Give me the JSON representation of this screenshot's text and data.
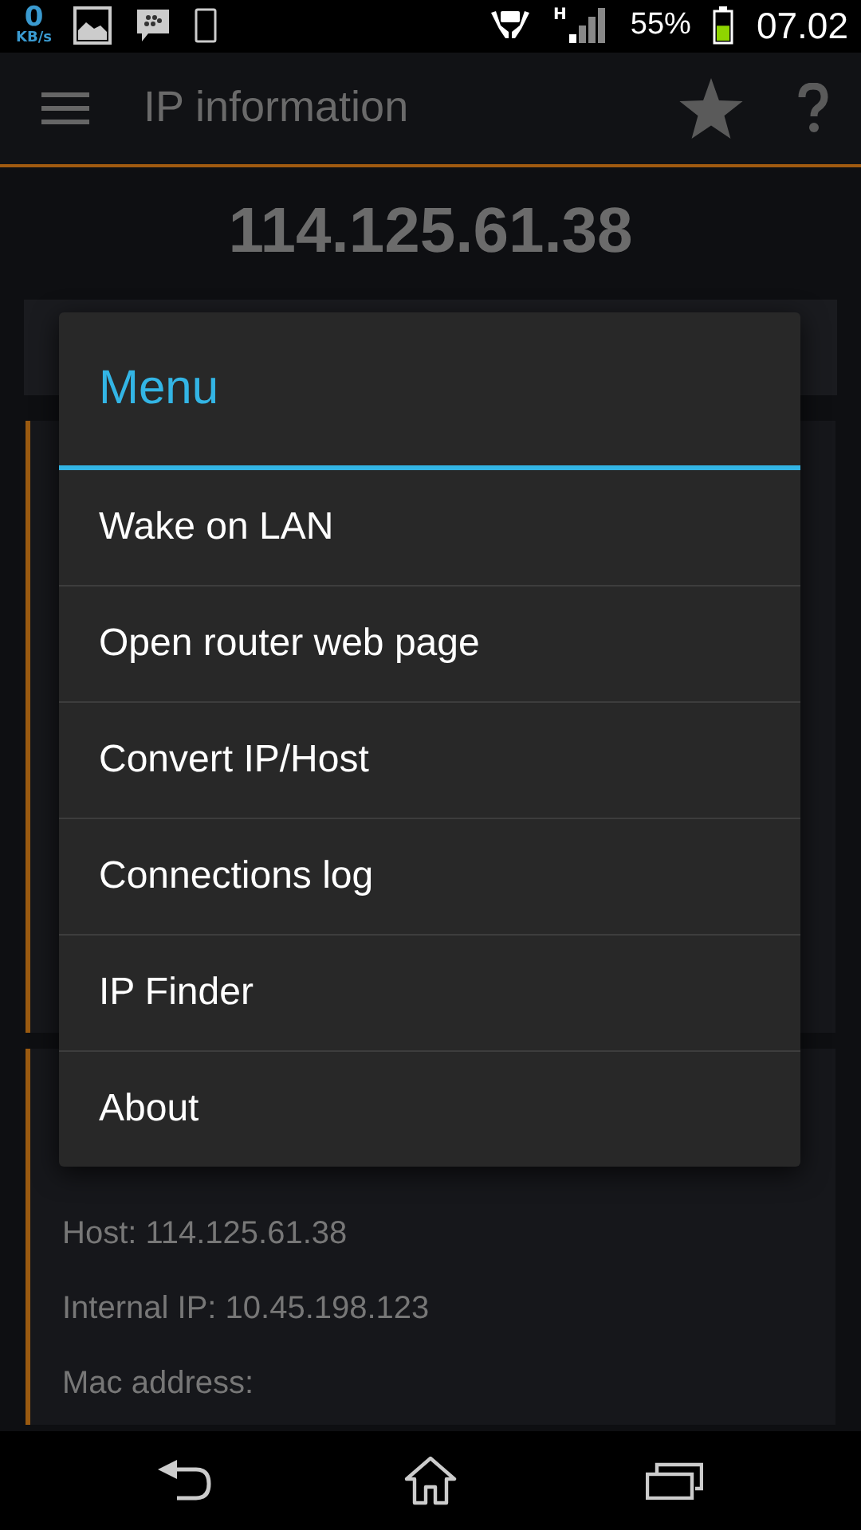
{
  "status_bar": {
    "speed_value": "0",
    "speed_unit": "KB/s",
    "network_type": "H",
    "battery": {
      "reading": "55%",
      "level": 0.55
    },
    "time": "07.02"
  },
  "app_bar": {
    "title": "IP information"
  },
  "ip_address": "114.125.61.38",
  "details": [
    "Host: 114.125.61.38",
    "Internal IP: 10.45.198.123",
    "Mac address:"
  ],
  "menu": {
    "title": "Menu",
    "items": [
      "Wake on LAN",
      "Open router web page",
      "Convert IP/Host",
      "Connections log",
      "IP Finder",
      "About"
    ]
  }
}
